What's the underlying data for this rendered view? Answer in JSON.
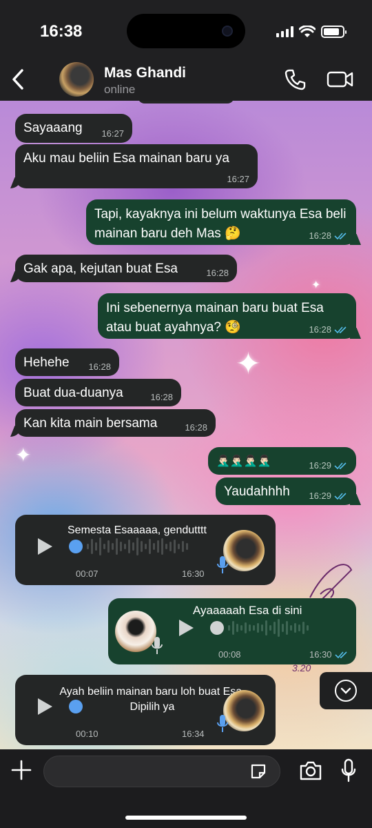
{
  "status_bar": {
    "time": "16:38"
  },
  "header": {
    "contact_name": "Mas Ghandi",
    "contact_status": "online"
  },
  "messages": [
    {
      "text": "Sayaaang",
      "time": "16:27"
    },
    {
      "text": "Aku mau beliin Esa mainan baru ya",
      "time": "16:27"
    },
    {
      "text": "Tapi, kayaknya ini belum waktunya Esa beli mainan baru deh Mas 🤔",
      "time": "16:28"
    },
    {
      "text": "Gak apa, kejutan buat Esa",
      "time": "16:28"
    },
    {
      "text": "Ini sebenernya mainan baru buat Esa atau buat ayahnya? 🧐",
      "time": "16:28"
    },
    {
      "text": "Hehehe",
      "time": "16:28"
    },
    {
      "text": "Buat dua-duanya",
      "time": "16:28"
    },
    {
      "text": "Kan kita main bersama",
      "time": "16:28"
    },
    {
      "text": "🤦🏻‍♂️🤦🏻‍♂️🤦🏻‍♂️🤦🏻‍♂️",
      "time": "16:29"
    },
    {
      "text": "Yaudahhhh",
      "time": "16:29"
    }
  ],
  "voice_notes": [
    {
      "caption": "Semesta Esaaaaa, gendutttt",
      "duration": "00:07",
      "time": "16:30"
    },
    {
      "caption": "Ayaaaaah Esa di sini",
      "duration": "00:08",
      "time": "16:30"
    },
    {
      "caption": "Ayah beliin mainan baru loh buat Esa. Dipilih ya",
      "duration": "00:10",
      "time": "16:34"
    }
  ],
  "handwriting": "3.20",
  "composer": {
    "placeholder": ""
  },
  "colors": {
    "incoming_bubble": "#242626",
    "outgoing_bubble": "#17422e",
    "read_ticks": "#53bdeb",
    "voice_dot": "#5aa0f0"
  }
}
